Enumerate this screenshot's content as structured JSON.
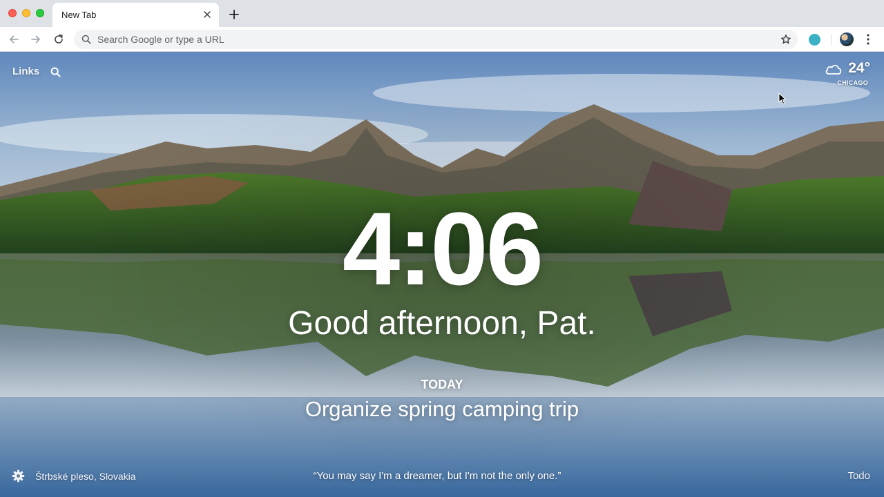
{
  "browser": {
    "tab_title": "New Tab",
    "omnibox_placeholder": "Search Google or type a URL",
    "icons": [
      "back-arrow-icon",
      "forward-arrow-icon",
      "reload-icon",
      "search-icon",
      "star-icon",
      "menu-icon",
      "close-icon",
      "plus-icon"
    ]
  },
  "dashboard": {
    "links_label": "Links",
    "weather": {
      "temperature": "24°",
      "location": "CHICAGO",
      "icon": "cloud-icon"
    },
    "clock": "4:06",
    "greeting": "Good afternoon, Pat.",
    "focus": {
      "label": "TODAY",
      "text": "Organize spring camping trip"
    },
    "photo_location": "Štrbské pleso, Slovakia",
    "quote": "“You may say I'm a dreamer, but I'm not the only one.”",
    "todo_label": "Todo"
  },
  "colors": {
    "tabstrip": "#dee1e6",
    "omnibox": "#f1f3f4",
    "extension": "#3db1c4",
    "text_on_photo": "#ffffff"
  }
}
